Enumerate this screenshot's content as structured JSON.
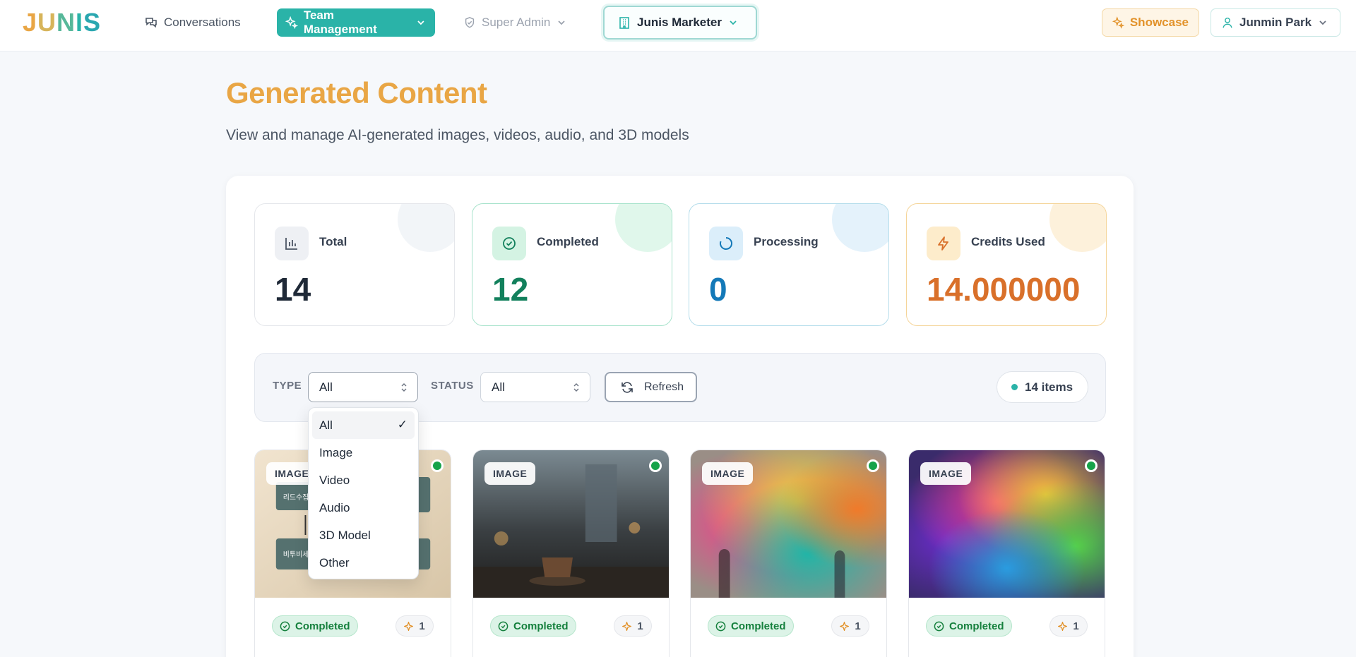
{
  "nav": {
    "logo": [
      "J",
      "U",
      "N",
      "I",
      "S"
    ],
    "conversations": "Conversations",
    "team_management": "Team Management",
    "super_admin": "Super Admin",
    "org": "Junis Marketer",
    "showcase": "Showcase",
    "user": "Junmin Park"
  },
  "page": {
    "title": "Generated Content",
    "subtitle": "View and manage AI-generated images, videos, audio, and 3D models"
  },
  "stats": [
    {
      "label": "Total",
      "value": "14",
      "icon": "bar-chart-icon",
      "color": "#1f2937"
    },
    {
      "label": "Completed",
      "value": "12",
      "icon": "check-circle-icon",
      "color": "#12805c"
    },
    {
      "label": "Processing",
      "value": "0",
      "icon": "spinner-icon",
      "color": "#1479b8"
    },
    {
      "label": "Credits Used",
      "value": "14.000000",
      "icon": "lightning-icon",
      "color": "#d9702a"
    }
  ],
  "filters": {
    "type_label": "TYPE",
    "type_value": "All",
    "status_label": "STATUS",
    "status_value": "All",
    "refresh": "Refresh",
    "count": "14 items"
  },
  "type_options": [
    {
      "label": "All",
      "selected": true
    },
    {
      "label": "Image",
      "selected": false
    },
    {
      "label": "Video",
      "selected": false
    },
    {
      "label": "Audio",
      "selected": false
    },
    {
      "label": "3D Model",
      "selected": false
    },
    {
      "label": "Other",
      "selected": false
    }
  ],
  "cards": [
    {
      "type": "IMAGE",
      "status": "Completed",
      "credits": "1",
      "thumb_text": [
        "리드수집",
        "비투비세"
      ]
    },
    {
      "type": "IMAGE",
      "status": "Completed",
      "credits": "1"
    },
    {
      "type": "IMAGE",
      "status": "Completed",
      "credits": "1"
    },
    {
      "type": "IMAGE",
      "status": "Completed",
      "credits": "1"
    }
  ],
  "colors": {
    "brand_teal": "#2ab3a8",
    "title_gold": "#e9a645",
    "status_green": "#15803d"
  }
}
